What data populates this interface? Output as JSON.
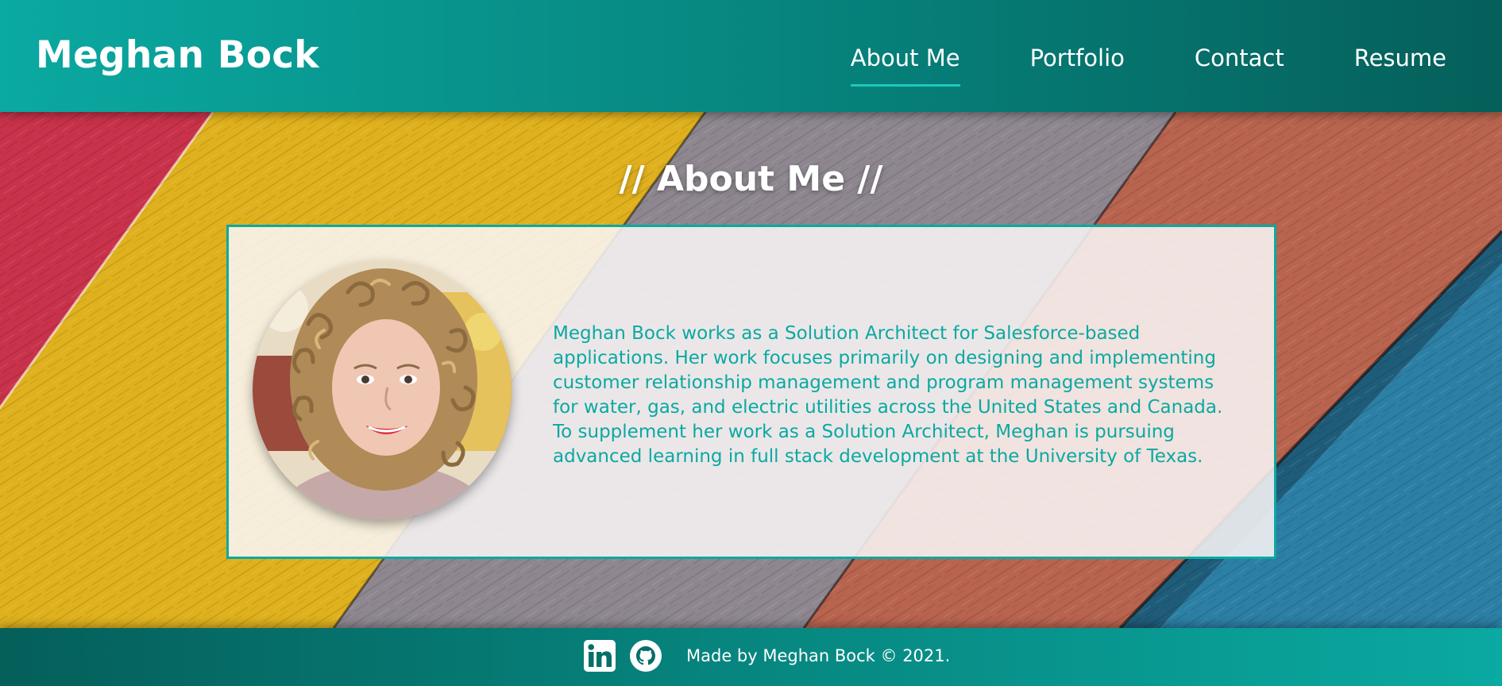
{
  "header": {
    "site_title": "Meghan Bock",
    "nav": [
      {
        "label": "About Me",
        "active": true
      },
      {
        "label": "Portfolio",
        "active": false
      },
      {
        "label": "Contact",
        "active": false
      },
      {
        "label": "Resume",
        "active": false
      }
    ]
  },
  "about": {
    "heading": "// About Me //",
    "bio": "Meghan Bock works as a Solution Architect for Salesforce-based applications. Her work focuses primarily on designing and implementing customer relationship management and program management systems for water, gas, and electric utilities across the United States and Canada. To supplement her work as a Solution Architect, Meghan is pursuing advanced learning in full stack development at the University of Texas.",
    "photo_icon": "profile-photo"
  },
  "footer": {
    "social": [
      {
        "icon": "linkedin-icon"
      },
      {
        "icon": "github-icon"
      }
    ],
    "credit": "Made by Meghan Bock © 2021."
  },
  "colors": {
    "accent": "#0aa9a1",
    "header_dark": "#055f5a",
    "text_white": "#ffffff"
  }
}
